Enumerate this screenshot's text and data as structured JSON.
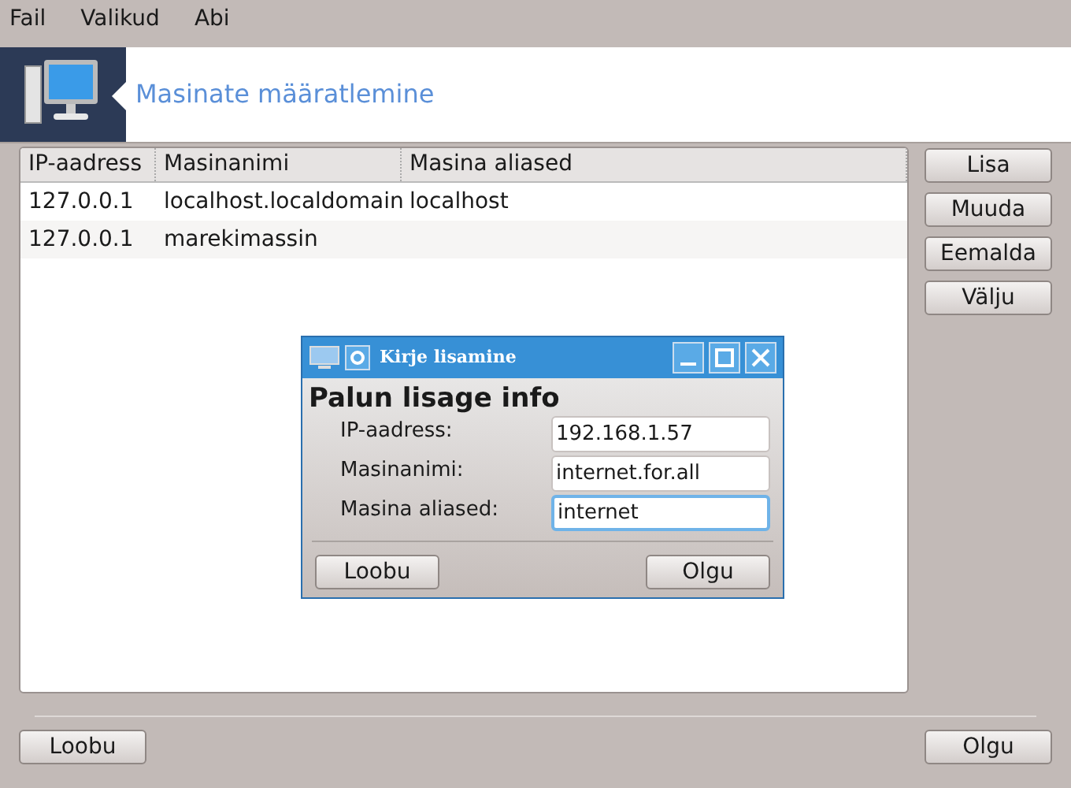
{
  "menu": [
    "Fail",
    "Valikud",
    "Abi"
  ],
  "header": {
    "title": "Masinate määratlemine"
  },
  "table": {
    "columns": [
      "IP-aadress",
      "Masinanimi",
      "Masina aliased"
    ],
    "rows": [
      [
        "127.0.0.1",
        "localhost.localdomain",
        "localhost"
      ],
      [
        "127.0.0.1",
        "marekimassin",
        ""
      ]
    ]
  },
  "side_buttons": [
    "Lisa",
    "Muuda",
    "Eemalda",
    "Välju"
  ],
  "dialog": {
    "title": "Kirje lisamine",
    "heading": "Palun lisage info",
    "fields": [
      {
        "label": "IP-aadress:",
        "value": "192.168.1.57",
        "focused": false
      },
      {
        "label": "Masinanimi:",
        "value": "internet.for.all",
        "focused": false
      },
      {
        "label": "Masina aliased:",
        "value": "internet",
        "focused": true
      }
    ],
    "buttons": [
      "Loobu",
      "Olgu"
    ]
  },
  "buttons": [
    "Loobu",
    "Olgu"
  ]
}
